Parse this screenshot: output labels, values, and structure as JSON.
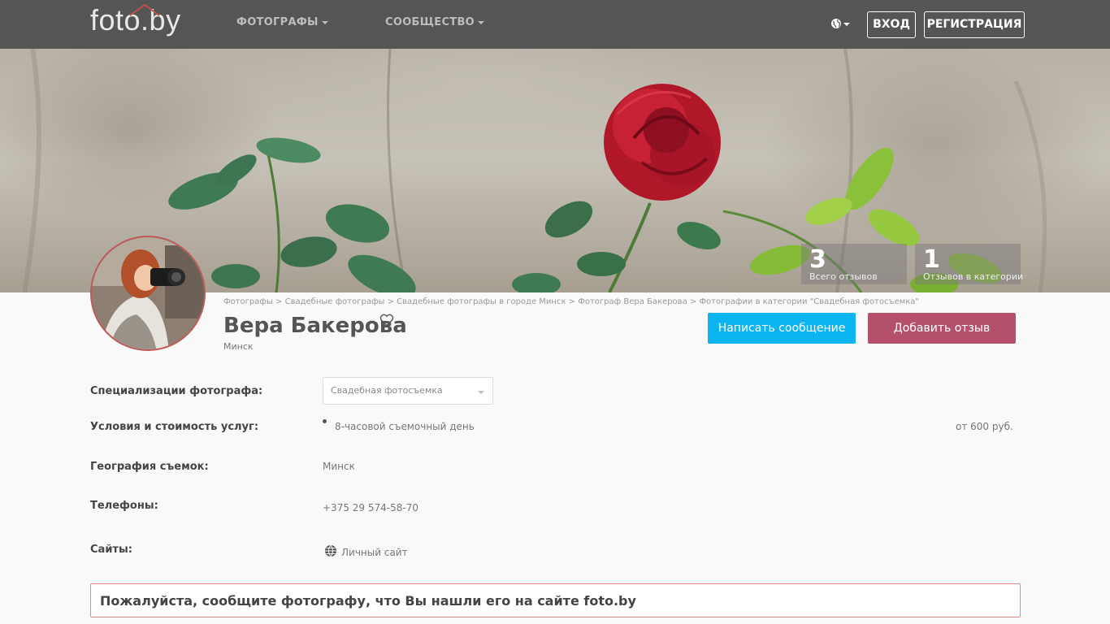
{
  "header": {
    "logo": "foto.by",
    "nav": [
      {
        "label": "ФОТОГРАФЫ"
      },
      {
        "label": "СООБЩЕСТВО"
      }
    ],
    "login_label": "ВХОД",
    "register_label": "РЕГИСТРАЦИЯ"
  },
  "stats": [
    {
      "value": "3",
      "label": "Всего отзывов"
    },
    {
      "value": "1",
      "label": "Отзывов в категории"
    }
  ],
  "breadcrumb": [
    "Фотографы",
    "Свадебные фотографы",
    "Свадебные фотографы в городе Минск",
    "Фотограф Вера Бакерова",
    "Фотографии в категории \"Свадебная фотосъемка\""
  ],
  "breadcrumb_separator": " > ",
  "profile": {
    "name": "Вера Бакерова",
    "city": "Минск",
    "message_button": "Написать сообщение",
    "review_button": "Добавить отзыв"
  },
  "details": {
    "specializations_label": "Специализации фотографа:",
    "specialization_selected": "Свадебная фотосъемка",
    "conditions_label": "Условия и стоимость услуг:",
    "service": "8-часовой съемочный день",
    "price": "от 600 руб.",
    "geography_label": "География съемок:",
    "geography": "Минск",
    "phones_label": "Телефоны:",
    "phone": "+375 29 574-58-70",
    "sites_label": "Сайты:",
    "site": "Личный сайт"
  },
  "notice": "Пожалуйста, сообщите фотографу, что Вы нашли его на сайте foto.by",
  "colors": {
    "header_bg": "#555555",
    "message_button": "#0cb4f2",
    "review_button": "#b4506a",
    "notice_border": "#e48a8a"
  }
}
